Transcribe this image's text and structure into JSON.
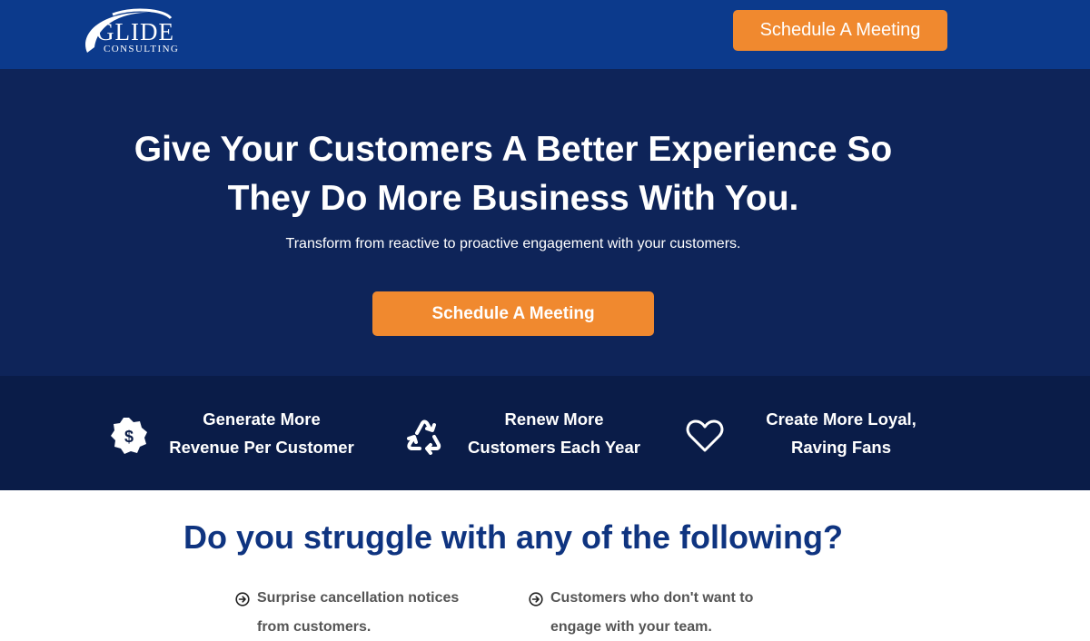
{
  "header": {
    "logo_main": "GLIDE",
    "logo_sub": "CONSULTING",
    "cta_label": "Schedule A Meeting"
  },
  "hero": {
    "title_line1": "Give Your Customers A Better Experience So",
    "title_line2": "They Do More Business With You.",
    "subtitle": "Transform from reactive to proactive engagement with your customers.",
    "cta_label": "Schedule A Meeting"
  },
  "benefits": [
    {
      "icon": "dollar-badge-icon",
      "line1": "Generate More",
      "line2": "Revenue Per Customer"
    },
    {
      "icon": "recycle-icon",
      "line1": "Renew More",
      "line2": "Customers Each Year"
    },
    {
      "icon": "heart-icon",
      "line1": "Create More Loyal,",
      "line2": "Raving Fans"
    }
  ],
  "struggle": {
    "title": "Do you struggle with any of the following?",
    "items": [
      {
        "icon": "arrow-circle-right-icon",
        "line1": "Surprise cancellation notices",
        "line2": "from customers."
      },
      {
        "icon": "arrow-circle-right-icon",
        "line1": "Customers who don't want to",
        "line2": "engage with your team."
      }
    ]
  },
  "colors": {
    "header_bg": "#0c3a8c",
    "hero_bg": "#0e2459",
    "benefits_bg": "#0a1c48",
    "accent_orange": "#f0892f",
    "heading_blue": "#0f3480",
    "body_gray": "#555555"
  }
}
